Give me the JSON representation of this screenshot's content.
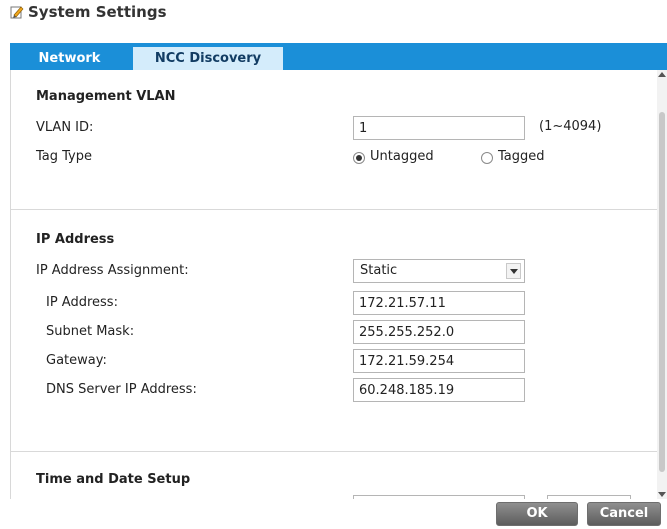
{
  "window": {
    "title": "System Settings"
  },
  "tabs": [
    {
      "label": "Network",
      "active": true
    },
    {
      "label": "NCC Discovery",
      "active": false
    }
  ],
  "management_vlan": {
    "title": "Management VLAN",
    "vlan_id_label": "VLAN ID:",
    "vlan_id_value": "1",
    "vlan_id_range": "(1~4094)",
    "tag_type_label": "Tag Type",
    "tag_options": [
      {
        "label": "Untagged",
        "selected": true
      },
      {
        "label": "Tagged",
        "selected": false
      }
    ]
  },
  "ip_address": {
    "title": "IP Address",
    "assignment_label": "IP Address Assignment:",
    "assignment_value": "Static",
    "ip_label": "IP Address:",
    "ip_value": "172.21.57.11",
    "subnet_label": "Subnet Mask:",
    "subnet_value": "255.255.252.0",
    "gateway_label": "Gateway:",
    "gateway_value": "172.21.59.254",
    "dns_label": "DNS Server IP Address:",
    "dns_value": "60.248.185.19"
  },
  "time_date": {
    "title": "Time and Date Setup"
  },
  "footer": {
    "ok_label": "OK",
    "cancel_label": "Cancel"
  },
  "colors": {
    "accent": "#1b8fd8",
    "inactive_tab": "#d4ecfb",
    "button": "#6e6e6e"
  }
}
